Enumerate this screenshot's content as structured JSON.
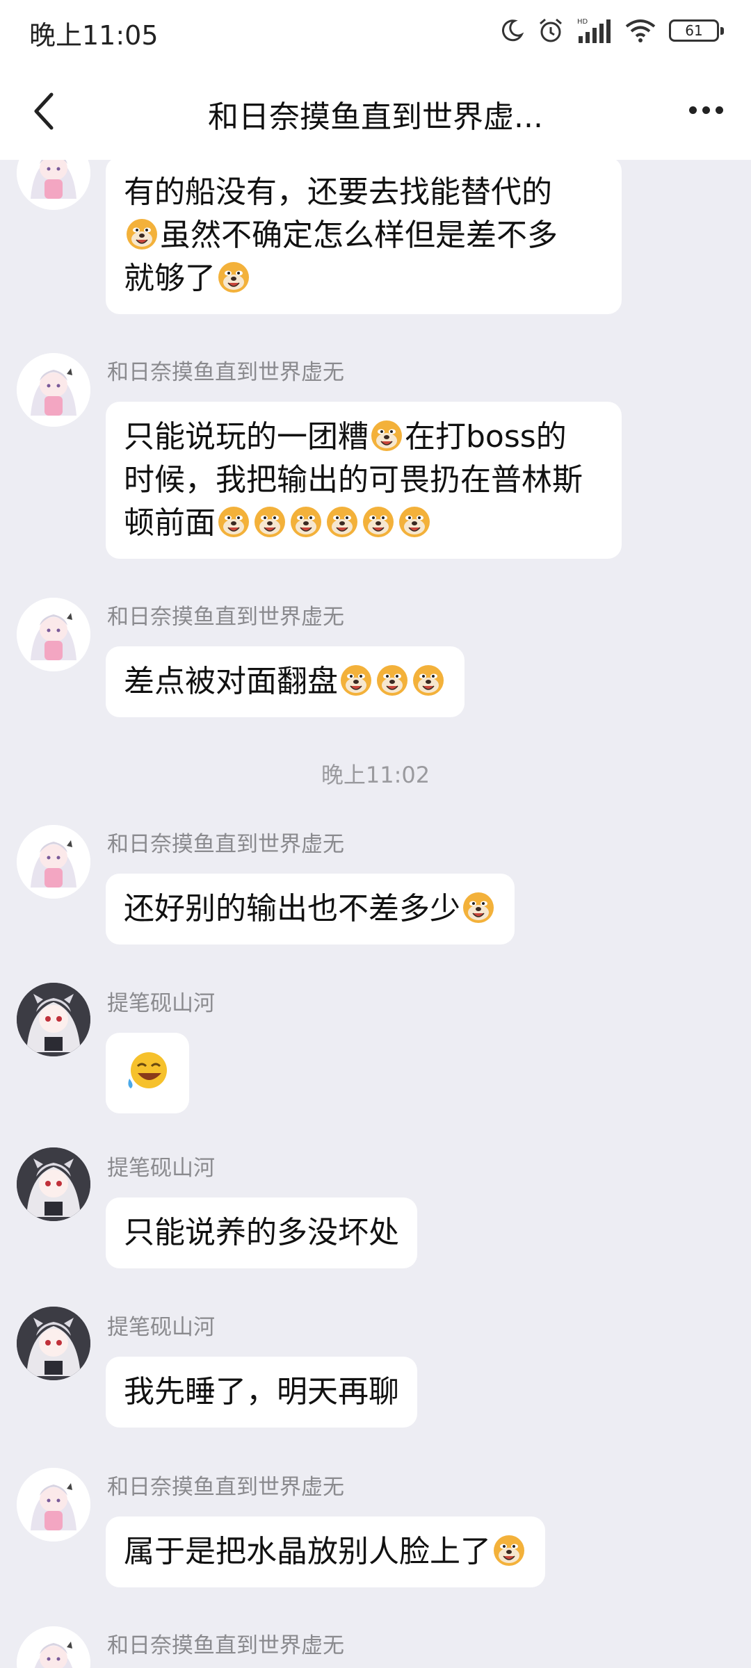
{
  "status_bar": {
    "time": "晚上11:05",
    "battery": "61",
    "icons": [
      "moon-icon",
      "alarm-icon",
      "hd-signal-icon",
      "wifi-icon",
      "battery-icon"
    ]
  },
  "header": {
    "title": "和日奈摸鱼直到世界虚...",
    "back_icon": "back-arrow-icon",
    "more_icon": "more-dots-icon"
  },
  "messages": [
    {
      "sender": "",
      "line1": "有的船没有，还要去找能替代的",
      "line2": "虽然不确定怎么样但是差不多",
      "line3": "就够了"
    },
    {
      "sender": "和日奈摸鱼直到世界虚无",
      "line1a": "只能说玩的一团糟",
      "line1b": "在打boss的",
      "line2": "时候，我把输出的可畏扔在普林斯",
      "line3": "顿前面"
    },
    {
      "sender": "和日奈摸鱼直到世界虚无",
      "text": "差点被对面翻盘"
    },
    {
      "time_separator": "晚上11:02"
    },
    {
      "sender": "和日奈摸鱼直到世界虚无",
      "text": "还好别的输出也不差多少"
    },
    {
      "sender": "提笔砚山河",
      "emoji": "laughing-crying-emoji"
    },
    {
      "sender": "提笔砚山河",
      "text": "只能说养的多没坏处"
    },
    {
      "sender": "提笔砚山河",
      "text": "我先睡了，明天再聊"
    },
    {
      "sender": "和日奈摸鱼直到世界虚无",
      "text": "属于是把水晶放别人脸上了"
    },
    {
      "sender": "和日奈摸鱼直到世界虚无"
    }
  ],
  "colors": {
    "background": "#ededf3",
    "bubble": "#ffffff",
    "sender_text": "#8a8a8e",
    "dog_emoji": "#f3b13a"
  }
}
